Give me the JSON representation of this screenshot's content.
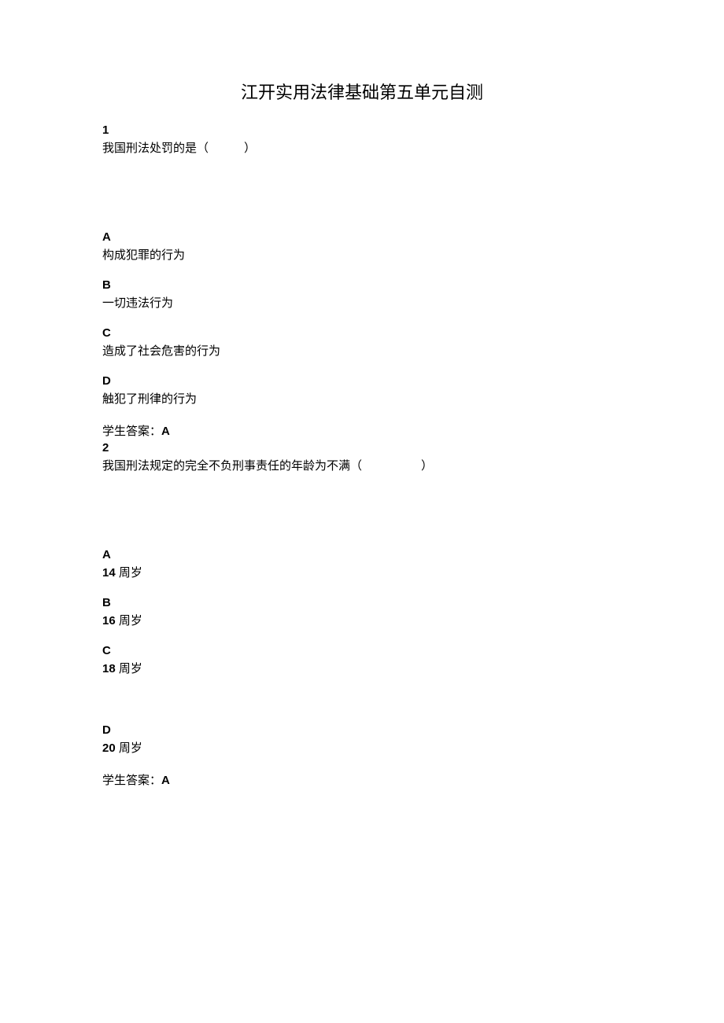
{
  "title": "江开实用法律基础第五单元自测",
  "questions": [
    {
      "number": "1",
      "stem": "我国刑法处罚的是（　　　）",
      "options": [
        {
          "label": "A",
          "text": "构成犯罪的行为"
        },
        {
          "label": "B",
          "text": "一切违法行为"
        },
        {
          "label": "C",
          "text": "造成了社会危害的行为"
        },
        {
          "label": "D",
          "text": "触犯了刑律的行为"
        }
      ],
      "answer_prefix": "学生答案：",
      "answer": "A"
    },
    {
      "number": "2",
      "stem": "我国刑法规定的完全不负刑事责任的年龄为不满（　　　　　）",
      "options": [
        {
          "label": "A",
          "num": "14",
          "text_suffix": " 周岁"
        },
        {
          "label": "B",
          "num": "16",
          "text_suffix": " 周岁"
        },
        {
          "label": "C",
          "num": "18",
          "text_suffix": " 周岁"
        },
        {
          "label": "D",
          "num": "20",
          "text_suffix": " 周岁"
        }
      ],
      "answer_prefix": "学生答案：",
      "answer": "A"
    }
  ]
}
